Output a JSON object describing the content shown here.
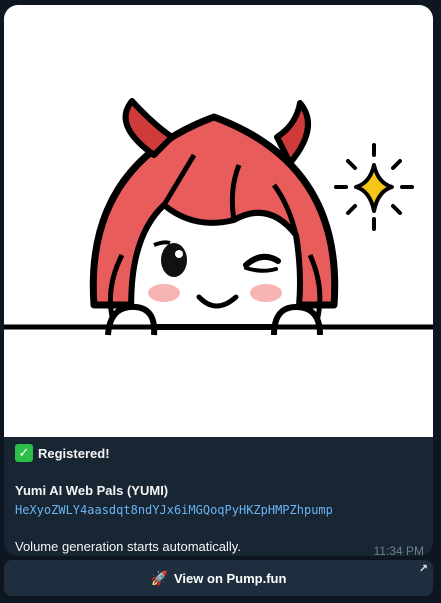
{
  "message": {
    "status_text": "Registered!",
    "status_icon": "check-mark-icon",
    "token_name": "Yumi AI Web Pals (YUMI)",
    "token_address": "HeXyoZWLY4aasdqt8ndYJx6iMGQoqPyHKZpHMPZhpump",
    "volume_text": "Volume generation starts automatically.",
    "timestamp": "11:34 PM",
    "image_icon": "devil-girl-mascot-illustration"
  },
  "button": {
    "label": "View on Pump.fun",
    "icon": "rocket-icon",
    "corner_icon": "external-link-arrow-icon"
  },
  "colors": {
    "background": "#0e1621",
    "bubble": "#182533",
    "link": "#6ab3f3",
    "button": "#1f2e3e",
    "timestamp": "#6d7f8f",
    "accent_red": "#e85c5c"
  }
}
